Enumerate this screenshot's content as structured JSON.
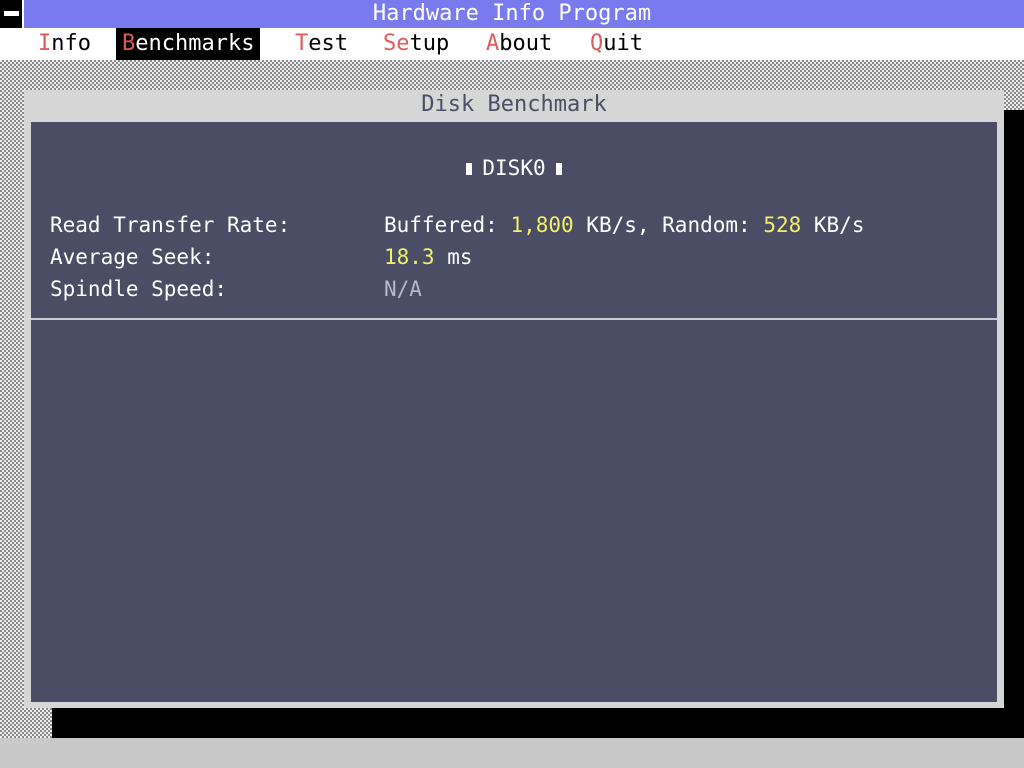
{
  "app": {
    "title": "Hardware Info Program"
  },
  "menu": [
    {
      "hot": "I",
      "rest": "nfo",
      "active": false
    },
    {
      "hot": "B",
      "rest": "enchmarks",
      "active": true
    },
    {
      "hot": "T",
      "rest": "est",
      "active": false
    },
    {
      "hot": "Se",
      "rest": "tup",
      "active": false
    },
    {
      "hot": "A",
      "rest": "bout",
      "active": false
    },
    {
      "hot": "Q",
      "rest": "uit",
      "active": false
    }
  ],
  "window": {
    "title": "Disk Benchmark"
  },
  "disk": {
    "name": "DISK0",
    "read_label": "Read Transfer Rate:",
    "buffered_label": "Buffered: ",
    "buffered_value": "1,800",
    "buffered_unit": " KB/s, Random: ",
    "random_value": "528",
    "random_unit": " KB/s",
    "seek_label": "Average Seek:",
    "seek_value": "18.3",
    "seek_unit": " ms",
    "spindle_label": "Spindle Speed:",
    "spindle_value": "N/A"
  },
  "colors": {
    "titlebar": "#7a7aef",
    "hotkey": "#e05a5a",
    "pane": "#4b4d65",
    "number": "#f2f06a"
  }
}
